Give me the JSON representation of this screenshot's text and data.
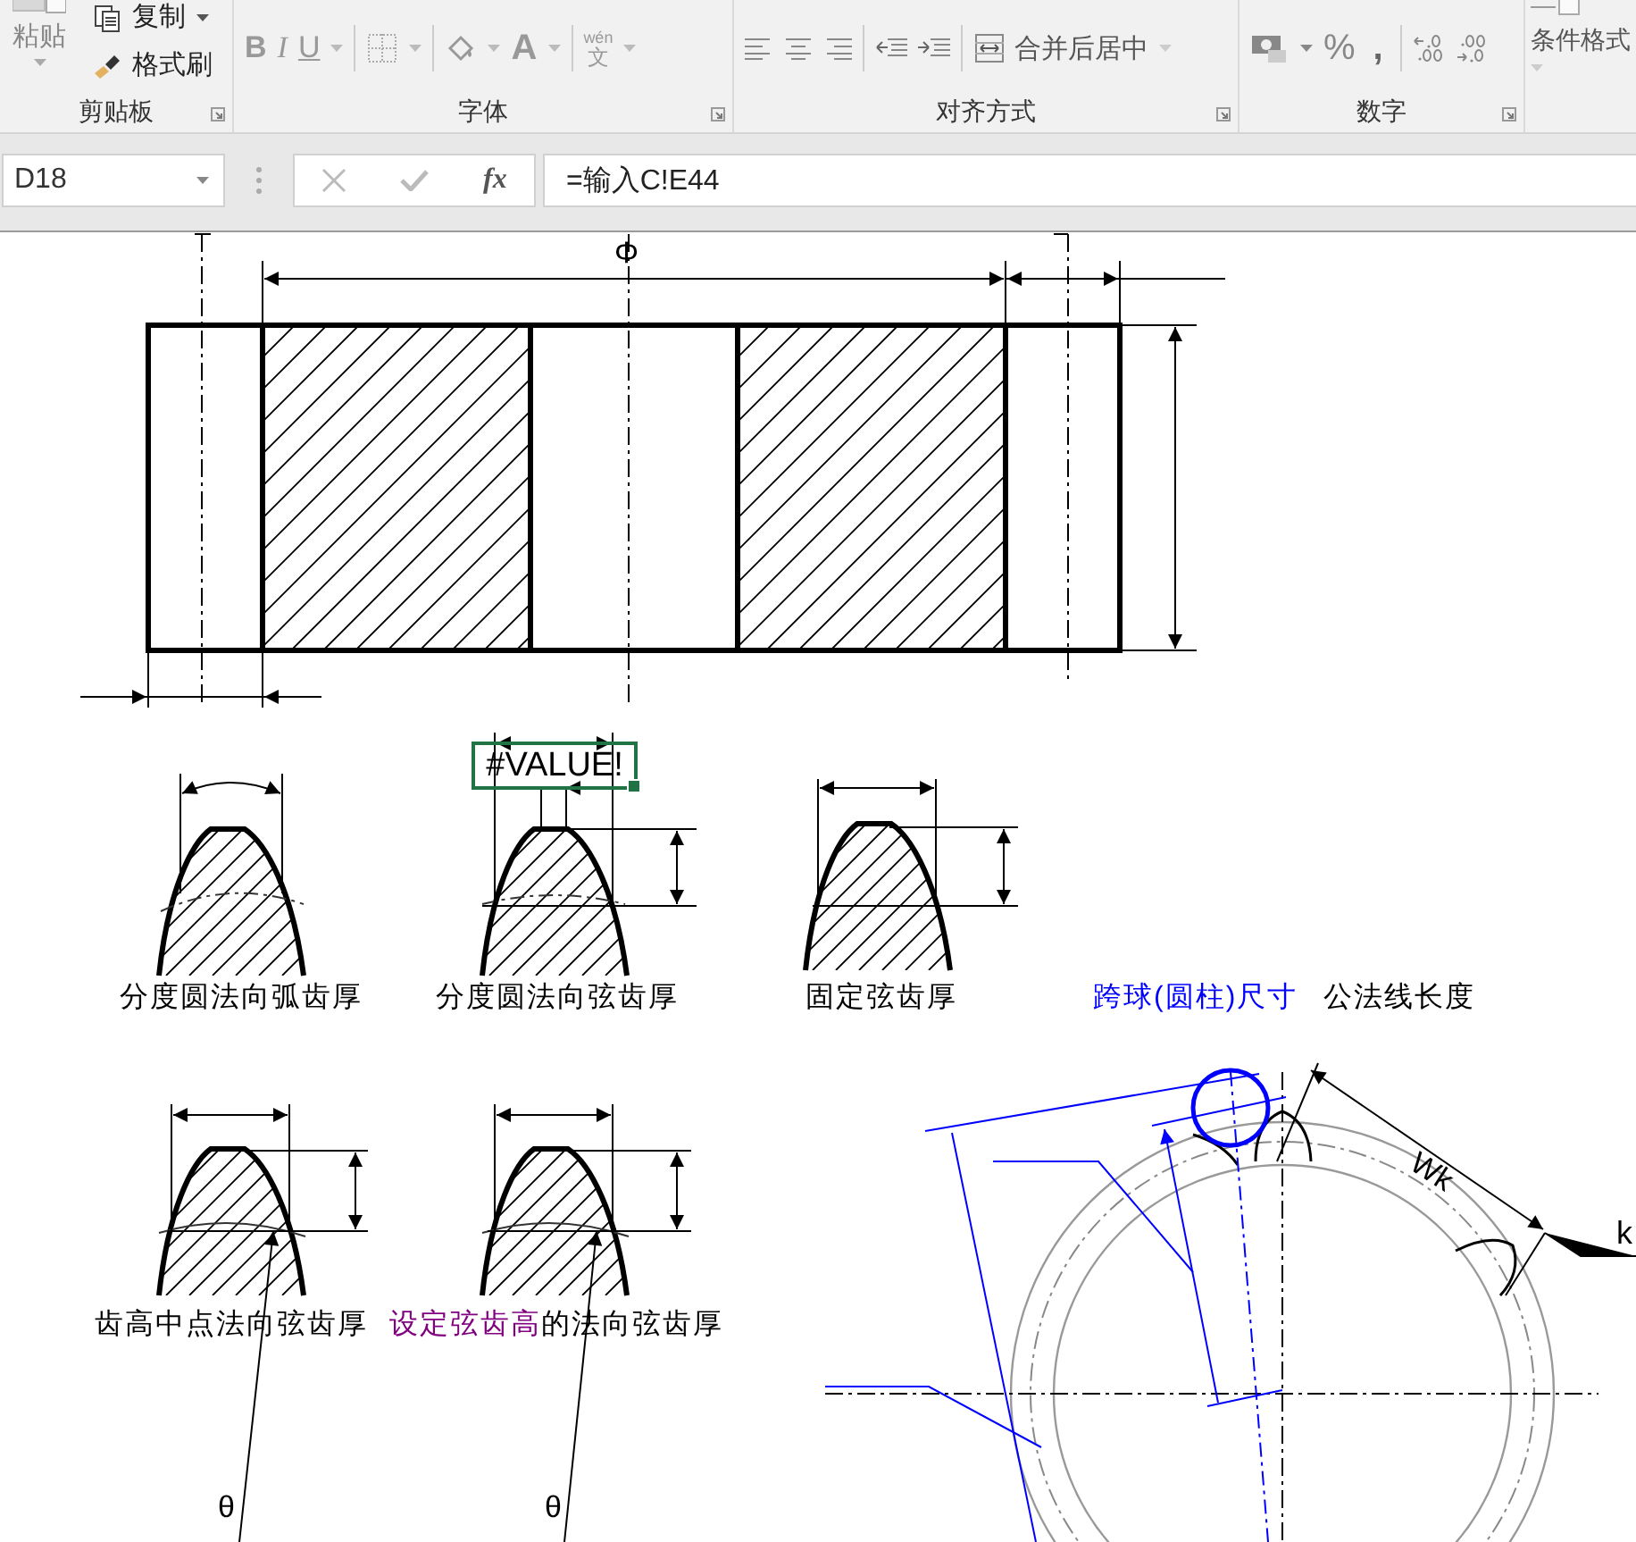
{
  "ribbon": {
    "groups": [
      {
        "kind": "clipboard",
        "label": "剪贴板",
        "paste": "粘贴",
        "copy": "复制",
        "format_painter": "格式刷"
      },
      {
        "kind": "font",
        "label": "字体",
        "bold": "B",
        "italic": "I",
        "underline": "U",
        "font_color": "A",
        "phonetic_top": "wén",
        "phonetic_bottom": "文"
      },
      {
        "kind": "alignment",
        "label": "对齐方式",
        "merge": "合并后居中"
      },
      {
        "kind": "number",
        "label": "数字",
        "percent": "%",
        "comma": ","
      },
      {
        "kind": "styles",
        "conditional_format": "条件格式"
      }
    ]
  },
  "formula_bar": {
    "name_box": "D18",
    "function_button": "fx",
    "formula": "=输入C!E44"
  },
  "sheet": {
    "diameter_symbol": "Φ",
    "cell": {
      "text": "#VALUE!",
      "selected": true
    },
    "captions": [
      {
        "parts": [
          {
            "text": "分度圆法向弧齿厚",
            "color": "#000000"
          }
        ]
      },
      {
        "parts": [
          {
            "text": "分度圆法向弦齿厚",
            "color": "#000000"
          }
        ]
      },
      {
        "parts": [
          {
            "text": "固定弦齿厚",
            "color": "#000000"
          }
        ]
      },
      {
        "parts": [
          {
            "text": "跨球(圆柱)尺寸",
            "color": "#0000ff"
          }
        ]
      },
      {
        "parts": [
          {
            "text": "公法线长度",
            "color": "#000000"
          }
        ]
      },
      {
        "parts": [
          {
            "text": "齿高中点法向弦齿厚",
            "color": "#000000"
          }
        ]
      },
      {
        "parts": [
          {
            "text": "设定弦齿高",
            "color": "#800080"
          },
          {
            "text": "的法向弦齿厚",
            "color": "#000000"
          }
        ]
      }
    ],
    "span_label": "Wk",
    "k_label": "k",
    "angle_symbols": [
      "θ",
      "θ"
    ]
  }
}
